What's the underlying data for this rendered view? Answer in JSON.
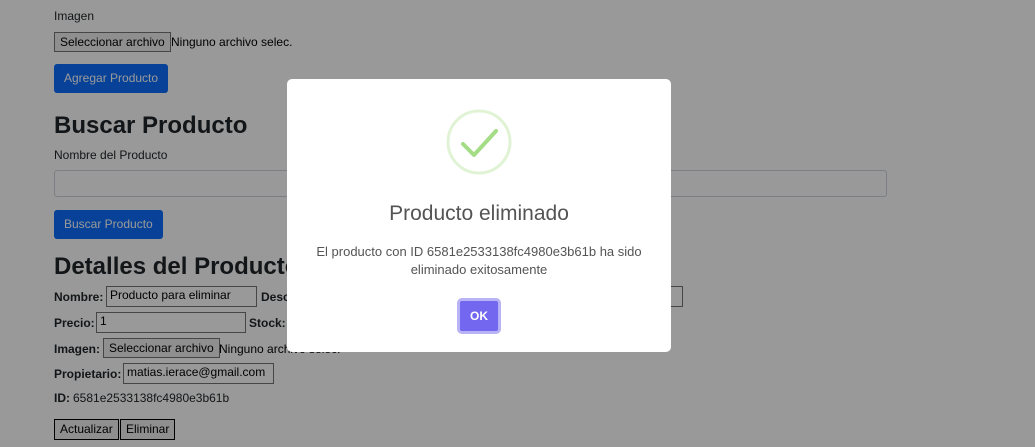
{
  "form": {
    "image_label": "Imagen",
    "file_button": "Seleccionar archivo",
    "file_status": "Ninguno archivo selec.",
    "add_button": "Agregar Producto"
  },
  "search": {
    "heading": "Buscar Producto",
    "name_label": "Nombre del Producto",
    "input_value": "",
    "button": "Buscar Producto"
  },
  "details": {
    "heading": "Detalles del Producto",
    "name_label": "Nombre:",
    "name_value": "Producto para eliminar",
    "desc_label": "Desc",
    "price_label": "Precio:",
    "price_value": "1",
    "stock_label": "Stock:",
    "image_label": "Imagen:",
    "file_button": "Seleccionar archivo",
    "file_status": "Ninguno archivo selec.",
    "owner_label": "Propietario:",
    "owner_value": "matias.ierace@gmail.com",
    "id_label": "ID:",
    "id_value": "6581e2533138fc4980e3b61b",
    "update_button": "Actualizar",
    "delete_button": "Eliminar"
  },
  "modal": {
    "icon": "success-check-icon",
    "title": "Producto eliminado",
    "message": "El producto con ID 6581e2533138fc4980e3b61b ha sido eliminado exitosamente",
    "ok_button": "OK"
  },
  "colors": {
    "primary": "#0d6efd",
    "ok": "#7367f0",
    "success": "#a5dc86"
  }
}
